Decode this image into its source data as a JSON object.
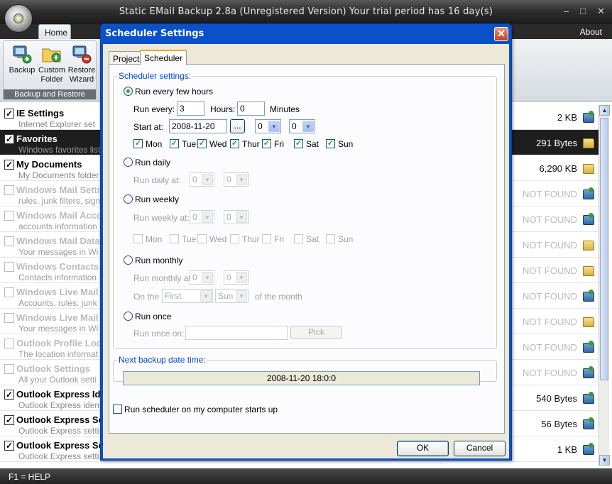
{
  "app": {
    "title": "Static EMail Backup 2.8a (Unregistered Version) Your trial period has 16 day(s)",
    "win_buttons": [
      "–",
      "□",
      "✕"
    ]
  },
  "ribbon": {
    "tabs": {
      "home": "Home",
      "about": "About"
    },
    "buttons": {
      "backup": "Backup",
      "custom_folder": "Custom Folder",
      "restore_wizard": "Restore Wizard"
    },
    "group_label": "Backup and Restore"
  },
  "list": {
    "items": [
      {
        "name": "IE Settings",
        "desc": "Internet Explorer set",
        "size": "2 KB",
        "checked": true,
        "icon": "pc-icon"
      },
      {
        "name": "Favorites",
        "desc": "Windows favorites list",
        "size": "291 Bytes",
        "checked": true,
        "icon": "folder-icon",
        "selected": true
      },
      {
        "name": "My Documents",
        "desc": "My Documents folder",
        "size": "6,290 KB",
        "checked": true,
        "icon": "folder-icon"
      },
      {
        "name": "Windows Mail Setti",
        "desc": "rules, junk filters, sign",
        "size": "NOT FOUND",
        "checked": false,
        "icon": "pc-icon",
        "disabled": true
      },
      {
        "name": "Windows Mail Acco",
        "desc": "accounts information",
        "size": "NOT FOUND",
        "checked": false,
        "icon": "pc-icon",
        "disabled": true
      },
      {
        "name": "Windows Mail Data",
        "desc": "Your messages in Wi",
        "size": "NOT FOUND",
        "checked": false,
        "icon": "folder-icon",
        "disabled": true
      },
      {
        "name": "Windows Contacts",
        "desc": "Contacts information",
        "size": "NOT FOUND",
        "checked": false,
        "icon": "folder-icon",
        "disabled": true
      },
      {
        "name": "Windows Live Mail S",
        "desc": "Accounts, rules, junk",
        "size": "NOT FOUND",
        "checked": false,
        "icon": "pc-icon",
        "disabled": true
      },
      {
        "name": "Windows Live Mail",
        "desc": "Your messages in Wi",
        "size": "NOT FOUND",
        "checked": false,
        "icon": "folder-icon",
        "disabled": true
      },
      {
        "name": "Outlook Profile Loc",
        "desc": "The location informat",
        "size": "NOT FOUND",
        "checked": false,
        "icon": "pc-icon",
        "disabled": true
      },
      {
        "name": "Outlook Settings",
        "desc": "All your Outlook setti",
        "size": "NOT FOUND",
        "checked": false,
        "icon": "pc-icon",
        "disabled": true
      },
      {
        "name": "Outlook Express Ide",
        "desc": "Outlook Express iden",
        "size": "540 Bytes",
        "checked": true,
        "icon": "pc-icon"
      },
      {
        "name": "Outlook Express Se",
        "desc": "Outlook Express setti",
        "size": "56 Bytes",
        "checked": true,
        "icon": "pc-icon"
      },
      {
        "name": "Outlook Express Se",
        "desc": "Outlook Express setti",
        "size": "1 KB",
        "checked": true,
        "icon": "pc-icon"
      }
    ]
  },
  "status": {
    "text": "F1 = HELP"
  },
  "dialog": {
    "title": "Scheduler Settings",
    "close": "✕",
    "tabs": {
      "project": "Project",
      "scheduler": "Scheduler"
    },
    "scheduler_legend": "Scheduler settings:",
    "few_hours": {
      "label": "Run every few hours",
      "run_every_label": "Run every:",
      "run_every_value": "3",
      "hours_label": "Hours:",
      "hours_value": "0",
      "minutes_label": "Minutes",
      "start_at_label": "Start at:",
      "start_date": "2008-11-20",
      "dots": "...",
      "start_hour": "0",
      "start_min": "0",
      "days": [
        {
          "label": "Mon",
          "checked": true
        },
        {
          "label": "Tue",
          "checked": true
        },
        {
          "label": "Wed",
          "checked": true
        },
        {
          "label": "Thur",
          "checked": true
        },
        {
          "label": "Fri",
          "checked": true
        },
        {
          "label": "Sat",
          "checked": true
        },
        {
          "label": "Sun",
          "checked": true
        }
      ]
    },
    "daily": {
      "label": "Run daily",
      "at_label": "Run daily at:",
      "hour": "0",
      "min": "0"
    },
    "weekly": {
      "label": "Run weekly",
      "at_label": "Run weekly at:",
      "hour": "0",
      "min": "0",
      "days": [
        "Mon",
        "Tue",
        "Wed",
        "Thur",
        "Fri",
        "Sat",
        "Sun"
      ]
    },
    "monthly": {
      "label": "Run monthly",
      "at_label": "Run monthly at:",
      "hour": "0",
      "min": "0",
      "on_the_label": "On the",
      "which": "First",
      "day": "Sun",
      "of_month_label": "of the month"
    },
    "once": {
      "label": "Run once",
      "on_label": "Run once on:",
      "pick": "Pick"
    },
    "next_legend": "Next backup date time:",
    "next_value": "2008-11-20 18:0:0",
    "startup_label": "Run scheduler on my computer starts up",
    "ok": "OK",
    "cancel": "Cancel"
  }
}
